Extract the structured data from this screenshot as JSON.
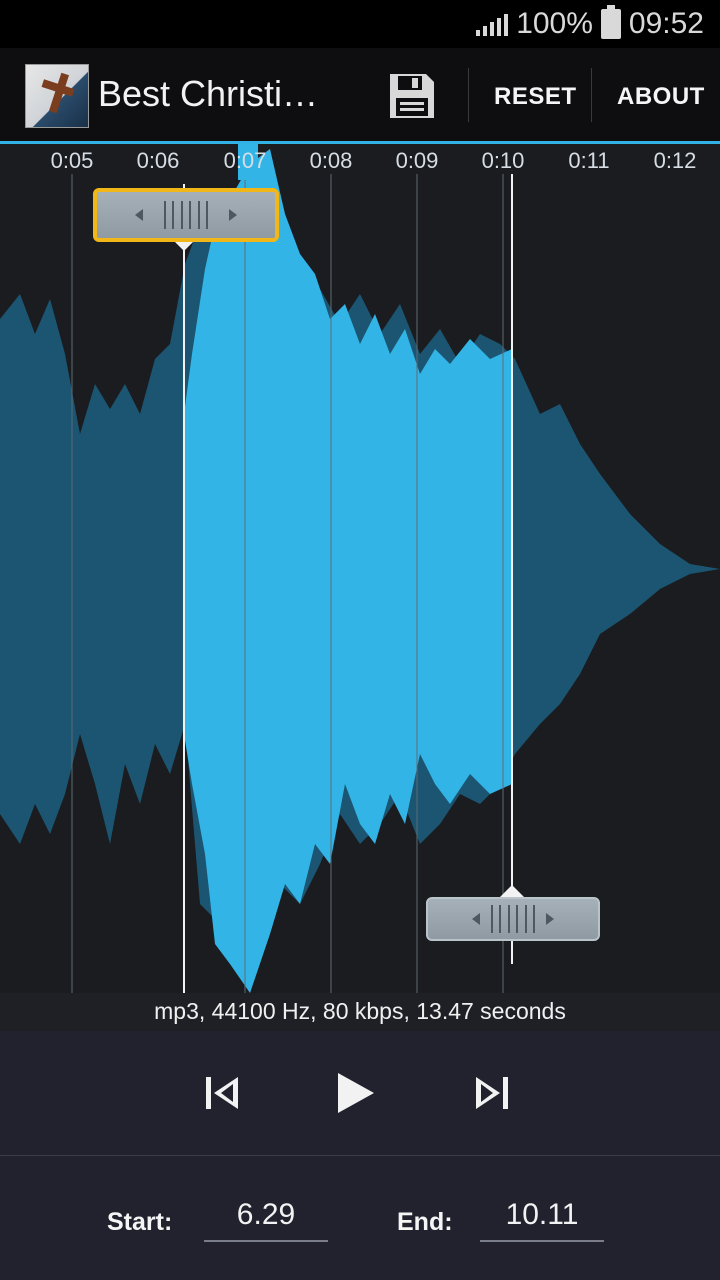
{
  "status_bar": {
    "battery_level": "100%",
    "time": "09:52"
  },
  "app_bar": {
    "title": "Best Christia…",
    "save_icon": "floppy-disk-icon",
    "reset_label": "RESET",
    "about_label": "ABOUT",
    "accent_color": "#31b2e5"
  },
  "timeline": {
    "ticks": [
      "0:05",
      "0:06",
      "0:07",
      "0:08",
      "0:09",
      "0:10",
      "0:11",
      "0:12"
    ],
    "selection_start_seconds": 6.29,
    "selection_end_seconds": 10.11
  },
  "info": {
    "text": "mp3, 44100 Hz, 80 kbps, 13.47 seconds"
  },
  "controls": {
    "prev_icon": "skip-previous-icon",
    "play_icon": "play-icon",
    "next_icon": "skip-next-icon"
  },
  "range": {
    "start_label": "Start:",
    "start_value": "6.29",
    "end_label": "End:",
    "end_value": "10.11"
  }
}
